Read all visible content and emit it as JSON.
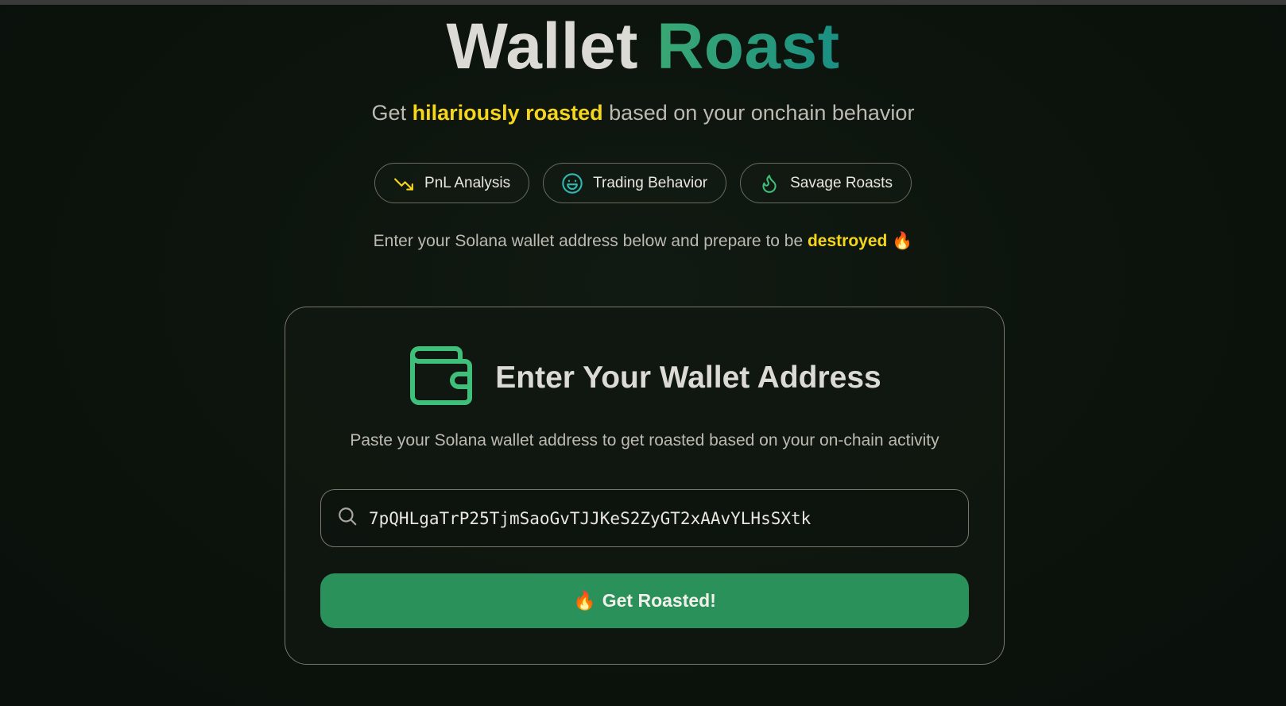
{
  "header": {
    "title_part1": "Wallet",
    "title_part2": "Roast",
    "subtitle_pre": "Get ",
    "subtitle_highlight": "hilariously roasted",
    "subtitle_post": " based on your onchain behavior"
  },
  "features": [
    {
      "label": "PnL Analysis",
      "icon": "trending-down-icon"
    },
    {
      "label": "Trading Behavior",
      "icon": "smile-face-icon"
    },
    {
      "label": "Savage Roasts",
      "icon": "flame-icon"
    }
  ],
  "prompt": {
    "text_pre": "Enter your Solana wallet address below and prepare to be ",
    "highlight": "destroyed",
    "emoji": "🔥"
  },
  "card": {
    "icon": "wallet-icon",
    "title": "Enter Your Wallet Address",
    "description": "Paste your Solana wallet address to get roasted based on your on-chain activity",
    "input_value": "7pQHLgaTrP25TjmSaoGvTJJKeS2ZyGT2xAAvYLHsSXtk",
    "button_emoji": "🔥",
    "button_label": "Get Roasted!"
  },
  "colors": {
    "accent_green": "#2b915a",
    "highlight_yellow": "#f6d61a",
    "teal": "#1a8f83",
    "background": "#0c140d"
  }
}
